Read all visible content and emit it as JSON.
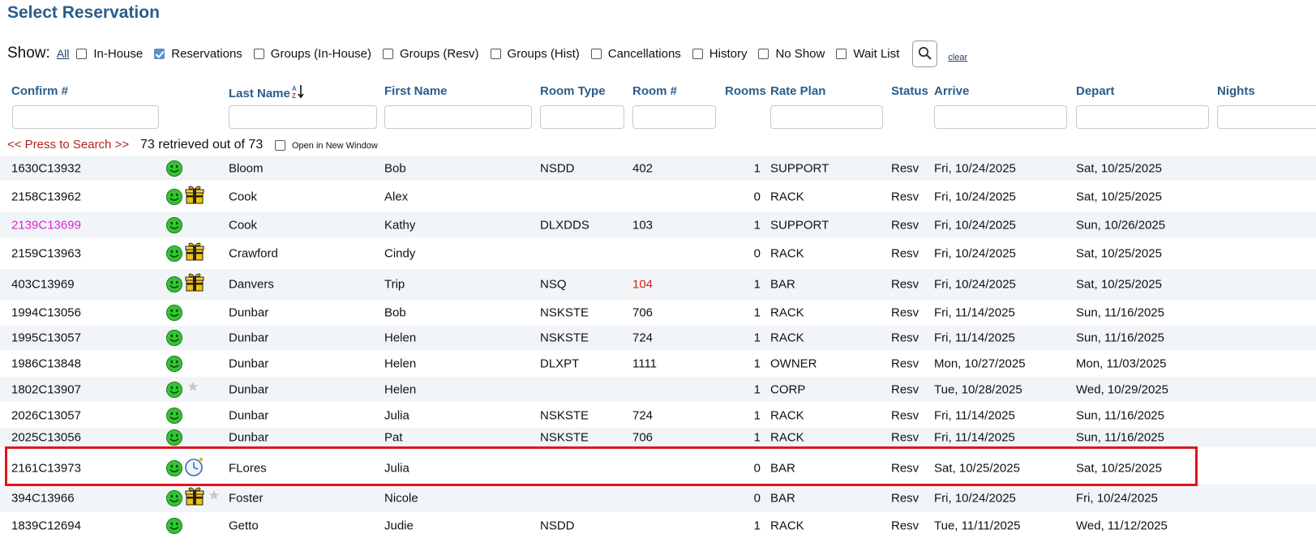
{
  "title": "Select Reservation",
  "filters": {
    "show_label": "Show:",
    "all_label": "All",
    "options": [
      {
        "label": "In-House",
        "checked": false
      },
      {
        "label": "Reservations",
        "checked": true
      },
      {
        "label": "Groups (In-House)",
        "checked": false
      },
      {
        "label": "Groups (Resv)",
        "checked": false
      },
      {
        "label": "Groups (Hist)",
        "checked": false
      },
      {
        "label": "Cancellations",
        "checked": false
      },
      {
        "label": "History",
        "checked": false
      },
      {
        "label": "No Show",
        "checked": false
      },
      {
        "label": "Wait List",
        "checked": false
      }
    ],
    "clear_label": "clear"
  },
  "columns": [
    "Confirm #",
    "Last Name",
    "First Name",
    "Room Type",
    "Room #",
    "Rooms",
    "Rate Plan",
    "Status",
    "Arrive",
    "Depart",
    "Nights"
  ],
  "press_to_search": "<< Press to Search >>",
  "retrieved_text": "73 retrieved out of 73",
  "open_new_window_label": "Open in New Window",
  "rows": [
    {
      "confirm": "1630C13932",
      "icons": [
        "smiley"
      ],
      "last": "Bloom",
      "first": "Bob",
      "room_type": "NSDD",
      "room": "402",
      "rooms": "1",
      "rate": "SUPPORT",
      "status": "Resv",
      "arrive": "Fri, 10/24/2025",
      "depart": "Sat, 10/25/2025"
    },
    {
      "confirm": "2158C13962",
      "icons": [
        "smiley",
        "gift"
      ],
      "last": "Cook",
      "first": "Alex",
      "room_type": "",
      "room": "",
      "rooms": "0",
      "rate": "RACK",
      "status": "Resv",
      "arrive": "Fri, 10/24/2025",
      "depart": "Sat, 10/25/2025"
    },
    {
      "confirm": "2139C13699",
      "confirm_color": "magenta",
      "icons": [
        "smiley"
      ],
      "last": "Cook",
      "first": "Kathy",
      "room_type": "DLXDDS",
      "room": "103",
      "rooms": "1",
      "rate": "SUPPORT",
      "status": "Resv",
      "arrive": "Fri, 10/24/2025",
      "depart": "Sun, 10/26/2025"
    },
    {
      "confirm": "2159C13963",
      "icons": [
        "smiley",
        "gift"
      ],
      "last": "Crawford",
      "first": "Cindy",
      "room_type": "",
      "room": "",
      "rooms": "0",
      "rate": "RACK",
      "status": "Resv",
      "arrive": "Fri, 10/24/2025",
      "depart": "Sat, 10/25/2025"
    },
    {
      "confirm": "403C13969",
      "icons": [
        "smiley",
        "gift"
      ],
      "last": "Danvers",
      "first": "Trip",
      "room_type": "NSQ",
      "room": "104",
      "room_color": "red",
      "rooms": "1",
      "rate": "BAR",
      "status": "Resv",
      "arrive": "Fri, 10/24/2025",
      "depart": "Sat, 10/25/2025"
    },
    {
      "confirm": "1994C13056",
      "icons": [
        "smiley"
      ],
      "last": "Dunbar",
      "first": "Bob",
      "room_type": "NSKSTE",
      "room": "706",
      "rooms": "1",
      "rate": "RACK",
      "status": "Resv",
      "arrive": "Fri, 11/14/2025",
      "depart": "Sun, 11/16/2025"
    },
    {
      "confirm": "1995C13057",
      "icons": [
        "smiley"
      ],
      "last": "Dunbar",
      "first": "Helen",
      "room_type": "NSKSTE",
      "room": "724",
      "rooms": "1",
      "rate": "RACK",
      "status": "Resv",
      "arrive": "Fri, 11/14/2025",
      "depart": "Sun, 11/16/2025"
    },
    {
      "confirm": "1986C13848",
      "icons": [
        "smiley"
      ],
      "last": "Dunbar",
      "first": "Helen",
      "room_type": "DLXPT",
      "room": "1111",
      "rooms": "1",
      "rate": "OWNER",
      "status": "Resv",
      "arrive": "Mon, 10/27/2025",
      "depart": "Mon, 11/03/2025"
    },
    {
      "confirm": "1802C13907",
      "icons": [
        "smiley",
        "star"
      ],
      "last": "Dunbar",
      "first": "Helen",
      "room_type": "",
      "room": "",
      "rooms": "1",
      "rate": "CORP",
      "status": "Resv",
      "arrive": "Tue, 10/28/2025",
      "depart": "Wed, 10/29/2025"
    },
    {
      "confirm": "2026C13057",
      "icons": [
        "smiley"
      ],
      "last": "Dunbar",
      "first": "Julia",
      "room_type": "NSKSTE",
      "room": "724",
      "rooms": "1",
      "rate": "RACK",
      "status": "Resv",
      "arrive": "Fri, 11/14/2025",
      "depart": "Sun, 11/16/2025"
    },
    {
      "confirm": "2025C13056",
      "icons": [
        "smiley"
      ],
      "last": "Dunbar",
      "first": "Pat",
      "room_type": "NSKSTE",
      "room": "706",
      "rooms": "1",
      "rate": "RACK",
      "status": "Resv",
      "arrive": "Fri, 11/14/2025",
      "depart": "Sun, 11/16/2025"
    },
    {
      "confirm": "2161C13973",
      "icons": [
        "smiley",
        "clock"
      ],
      "last": "FLores",
      "first": "Julia",
      "room_type": "",
      "room": "",
      "rooms": "0",
      "rate": "BAR",
      "status": "Resv",
      "arrive": "Sat, 10/25/2025",
      "depart": "Sat, 10/25/2025",
      "highlighted": true
    },
    {
      "confirm": "394C13966",
      "icons": [
        "smiley",
        "gift",
        "star"
      ],
      "last": "Foster",
      "first": "Nicole",
      "room_type": "",
      "room": "",
      "rooms": "0",
      "rate": "BAR",
      "status": "Resv",
      "arrive": "Fri, 10/24/2025",
      "depart": "Fri, 10/24/2025"
    },
    {
      "confirm": "1839C12694",
      "icons": [
        "smiley"
      ],
      "last": "Getto",
      "first": "Judie",
      "room_type": "NSDD",
      "room": "",
      "rooms": "1",
      "rate": "RACK",
      "status": "Resv",
      "arrive": "Tue, 11/11/2025",
      "depart": "Wed, 11/12/2025"
    }
  ],
  "colors": {
    "header": "#2a5d8c",
    "magenta": "#e020d6",
    "red": "#e02020",
    "highlight": "#e0141e",
    "row_alt": "#f2f5f8"
  }
}
